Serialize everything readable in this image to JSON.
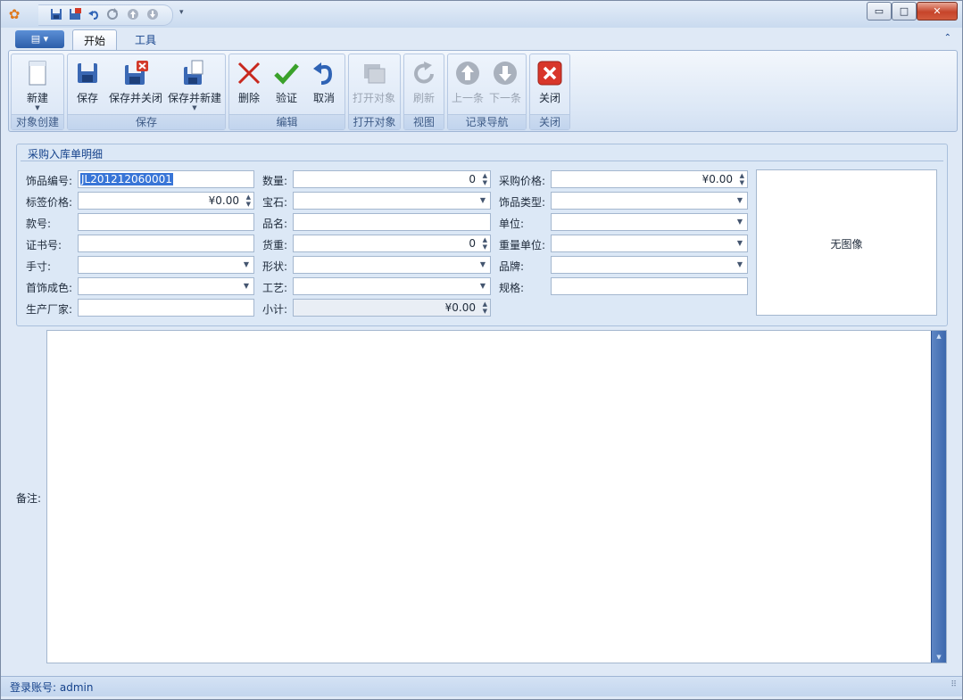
{
  "window": {
    "app_icon": "flower-icon",
    "quick_access": [
      "save-icon",
      "save-close-icon",
      "undo-icon",
      "redo-icon",
      "up-icon",
      "down-icon"
    ],
    "controls": {
      "minimize": "▭",
      "maximize": "□",
      "close": "✕"
    }
  },
  "ribbon": {
    "tabs": [
      {
        "label": "开始"
      },
      {
        "label": "工具"
      }
    ],
    "groups": [
      {
        "label": "对象创建",
        "buttons": [
          {
            "label": "新建"
          }
        ]
      },
      {
        "label": "保存",
        "buttons": [
          {
            "label": "保存"
          },
          {
            "label": "保存并关闭"
          },
          {
            "label": "保存并新建"
          }
        ]
      },
      {
        "label": "编辑",
        "buttons": [
          {
            "label": "删除"
          },
          {
            "label": "验证"
          },
          {
            "label": "取消"
          }
        ]
      },
      {
        "label": "打开对象",
        "buttons": [
          {
            "label": "打开对象"
          }
        ]
      },
      {
        "label": "视图",
        "buttons": [
          {
            "label": "刷新"
          }
        ]
      },
      {
        "label": "记录导航",
        "buttons": [
          {
            "label": "上一条"
          },
          {
            "label": "下一条"
          }
        ]
      },
      {
        "label": "关闭",
        "buttons": [
          {
            "label": "关闭"
          }
        ]
      }
    ]
  },
  "detail": {
    "title": "采购入库单明细",
    "fields": {
      "item_no": {
        "label": "饰品编号:",
        "value": "JL201212060001"
      },
      "tag_price": {
        "label": "标签价格:",
        "value": "¥0.00"
      },
      "style_no": {
        "label": "款号:",
        "value": ""
      },
      "cert_no": {
        "label": "证书号:",
        "value": ""
      },
      "size": {
        "label": "手寸:",
        "value": ""
      },
      "fineness": {
        "label": "首饰成色:",
        "value": ""
      },
      "manufacturer": {
        "label": "生产厂家:",
        "value": ""
      },
      "quantity": {
        "label": "数量:",
        "value": "0"
      },
      "gem": {
        "label": "宝石:",
        "value": ""
      },
      "product_name": {
        "label": "品名:",
        "value": ""
      },
      "goods_weight": {
        "label": "货重:",
        "value": "0"
      },
      "shape": {
        "label": "形状:",
        "value": ""
      },
      "craft": {
        "label": "工艺:",
        "value": ""
      },
      "subtotal": {
        "label": "小计:",
        "value": "¥0.00"
      },
      "purchase_price": {
        "label": "采购价格:",
        "value": "¥0.00"
      },
      "item_type": {
        "label": "饰品类型:",
        "value": ""
      },
      "unit": {
        "label": "单位:",
        "value": ""
      },
      "weight_unit": {
        "label": "重量单位:",
        "value": ""
      },
      "brand": {
        "label": "品牌:",
        "value": ""
      },
      "spec": {
        "label": "规格:",
        "value": ""
      }
    },
    "image_placeholder": "无图像"
  },
  "memo": {
    "label": "备注:",
    "value": ""
  },
  "status": {
    "text": "登录账号: admin"
  },
  "colors": {
    "accent": "#15428b",
    "frame": "#dfe9f6",
    "selection": "#3875d7"
  }
}
